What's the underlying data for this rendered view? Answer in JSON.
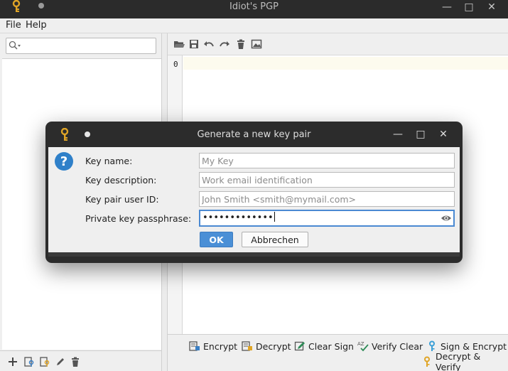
{
  "app": {
    "title": "Idiot's PGP"
  },
  "menu": {
    "file": "File",
    "help": "Help"
  },
  "search": {
    "placeholder": "",
    "value": ""
  },
  "editor": {
    "line_number": "0"
  },
  "actions": {
    "encrypt": "Encrypt",
    "decrypt": "Decrypt",
    "clear_sign": "Clear Sign",
    "verify_clear": "Verify Clear",
    "sign_encrypt": "Sign & Encrypt",
    "decrypt_verify": "Decrypt & Verify"
  },
  "dialog": {
    "title": "Generate a new key pair",
    "fields": {
      "key_name": {
        "label": "Key name:",
        "placeholder": "My Key"
      },
      "key_description": {
        "label": "Key description:",
        "placeholder": "Work email identification"
      },
      "user_id": {
        "label": "Key pair user ID:",
        "placeholder": "John Smith <smith@mymail.com>"
      },
      "passphrase": {
        "label": "Private key passphrase:",
        "masked_value": "•••••••••••••"
      }
    },
    "ok_label": "OK",
    "cancel_label": "Abbrechen"
  },
  "colors": {
    "accent": "#4a8fd6",
    "titlebar": "#2b2b2b",
    "key_gold": "#e0a526"
  }
}
